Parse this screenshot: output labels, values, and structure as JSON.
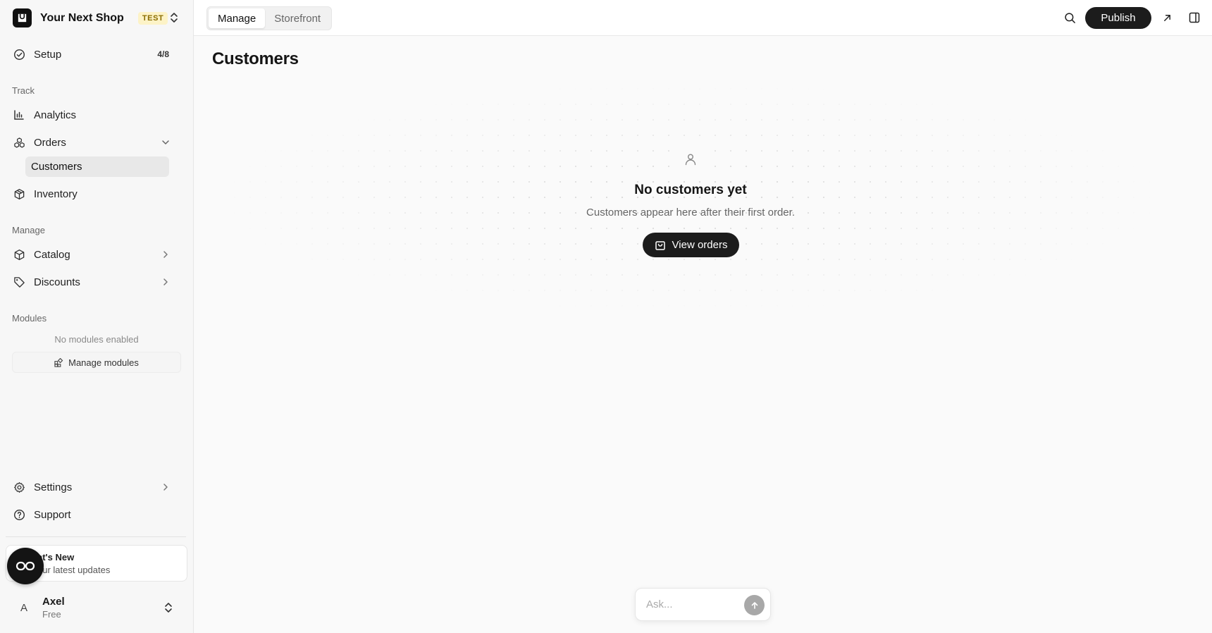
{
  "brand": {
    "name": "Your Next Shop",
    "badge": "TEST",
    "icon": "shop-bag-icon"
  },
  "sidebar": {
    "setup": {
      "label": "Setup",
      "count": "4/8",
      "icon": "check-circle-icon"
    },
    "sections": {
      "track": "Track",
      "manage": "Manage",
      "modules": "Modules"
    },
    "analytics": {
      "label": "Analytics",
      "icon": "bar-chart-icon"
    },
    "orders": {
      "label": "Orders",
      "icon": "orders-icon",
      "expanded": true
    },
    "customers": {
      "label": "Customers",
      "active": true
    },
    "inventory": {
      "label": "Inventory",
      "icon": "box-icon"
    },
    "catalog": {
      "label": "Catalog",
      "icon": "cube-icon"
    },
    "discounts": {
      "label": "Discounts",
      "icon": "tag-icon"
    },
    "modules": {
      "empty": "No modules enabled",
      "manage_label": "Manage modules"
    },
    "settings": {
      "label": "Settings",
      "icon": "gear-icon"
    },
    "support": {
      "label": "Support",
      "icon": "help-circle-icon"
    },
    "whats_new": {
      "title": "at's New",
      "subtitle": "our latest updates"
    },
    "user": {
      "initial": "A",
      "name": "Axel",
      "plan": "Free"
    }
  },
  "topbar": {
    "tabs": [
      {
        "label": "Manage",
        "active": true
      },
      {
        "label": "Storefront",
        "active": false
      }
    ],
    "publish_label": "Publish"
  },
  "main": {
    "title": "Customers",
    "empty": {
      "title": "No customers yet",
      "subtitle": "Customers appear here after their first order.",
      "button_label": "View orders"
    },
    "ask": {
      "placeholder": "Ask..."
    }
  },
  "colors": {
    "primary_dark": "#1c1c1c",
    "badge_bg": "#fdf3c7",
    "badge_text": "#8a6d00",
    "sidebar_bg": "#f7f7f7"
  }
}
